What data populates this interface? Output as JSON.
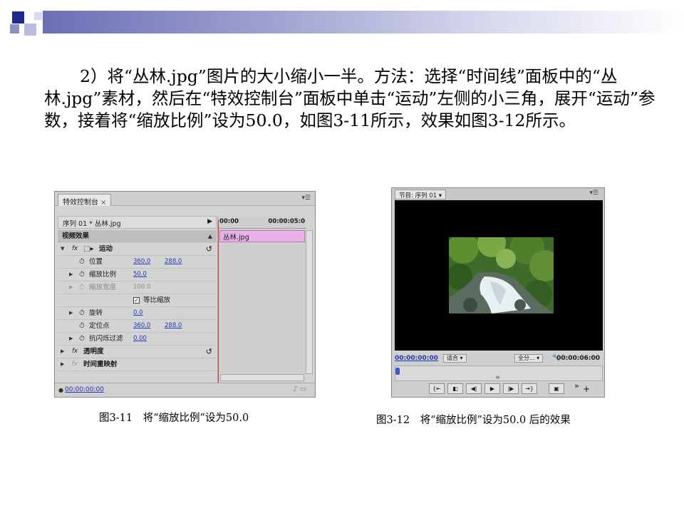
{
  "slide": {
    "paragraph": "2）将“丛林.jpg”图片的大小缩小一半。方法：选择“时间线”面板中的“丛林.jpg”素材，然后在“特效控制台”面板中单击“运动”左侧的小三角，展开“运动”参数，接着将“缩放比例”设为50.0，如图3-11所示，效果如图3-12所示。",
    "caption_left": "图3-11　将“缩放比例”设为50.0",
    "caption_right": "图3-12　将“缩放比例”设为50.0 后的效果"
  },
  "effect_controls": {
    "tab": "特效控制台",
    "tab_close": "×",
    "sequence_label": "序列 01 * 丛林.jpg",
    "time_start": "00:00",
    "time_end": "00:00:05:0",
    "clip_name": "丛林.jpg",
    "section_header": "视频效果",
    "motion": "运动",
    "position_label": "位置",
    "position_x": "360.0",
    "position_y": "288.0",
    "scale_label": "缩放比例",
    "scale_value": "50.0",
    "scale_width_label": "缩放宽度",
    "scale_width_value": "100.0",
    "uniform_scale_label": "等比缩放",
    "rotation_label": "旋转",
    "rotation_value": "0.0",
    "anchor_label": "定位点",
    "anchor_x": "360.0",
    "anchor_y": "288.0",
    "antiflicker_label": "抗闪烁过滤",
    "antiflicker_value": "0.00",
    "opacity_label": "透明度",
    "time_remap_label": "时间重映射",
    "footer_time": "00:00:00:00"
  },
  "program_monitor": {
    "tab": "节目: 序列 01",
    "timecode": "00:00:00:00",
    "fit_option": "适合",
    "quality_option": "全分...",
    "duration": "00:00:06:00"
  },
  "colors": {
    "header_gradient_start": "#6b6fb6",
    "clip_pink": "#e8b2e8",
    "link_blue": "#1f3ab3",
    "playhead_red": "#dd3333"
  }
}
